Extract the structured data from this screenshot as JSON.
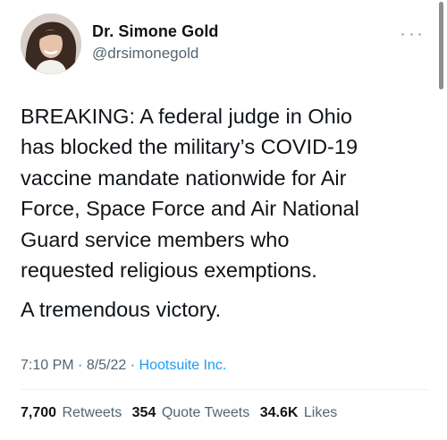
{
  "author": {
    "name": "Dr. Simone Gold",
    "handle": "@drsimonegold"
  },
  "tweet": {
    "lines": [
      "BREAKING: A federal judge in Ohio",
      "has blocked the military’s COVID-19",
      "vaccine mandate nationwide for Air",
      "Force, Space Force and Air National",
      "Guard service members who",
      "requested religious exemptions."
    ],
    "closing": "A tremendous victory."
  },
  "meta": {
    "time": "7:10 PM",
    "separator": " · ",
    "date": "8/5/22",
    "source": "Hootsuite Inc."
  },
  "stats": {
    "retweets_count": "7,700",
    "retweets_label": "Retweets",
    "quotes_count": "354",
    "quotes_label": "Quote Tweets",
    "likes_count": "34.6K",
    "likes_label": "Likes"
  },
  "icons": {
    "more": "more-options-icon",
    "avatar": "profile-photo"
  },
  "colors": {
    "text": "#0f1419",
    "secondary": "#536471",
    "link": "#1d9bf0"
  }
}
